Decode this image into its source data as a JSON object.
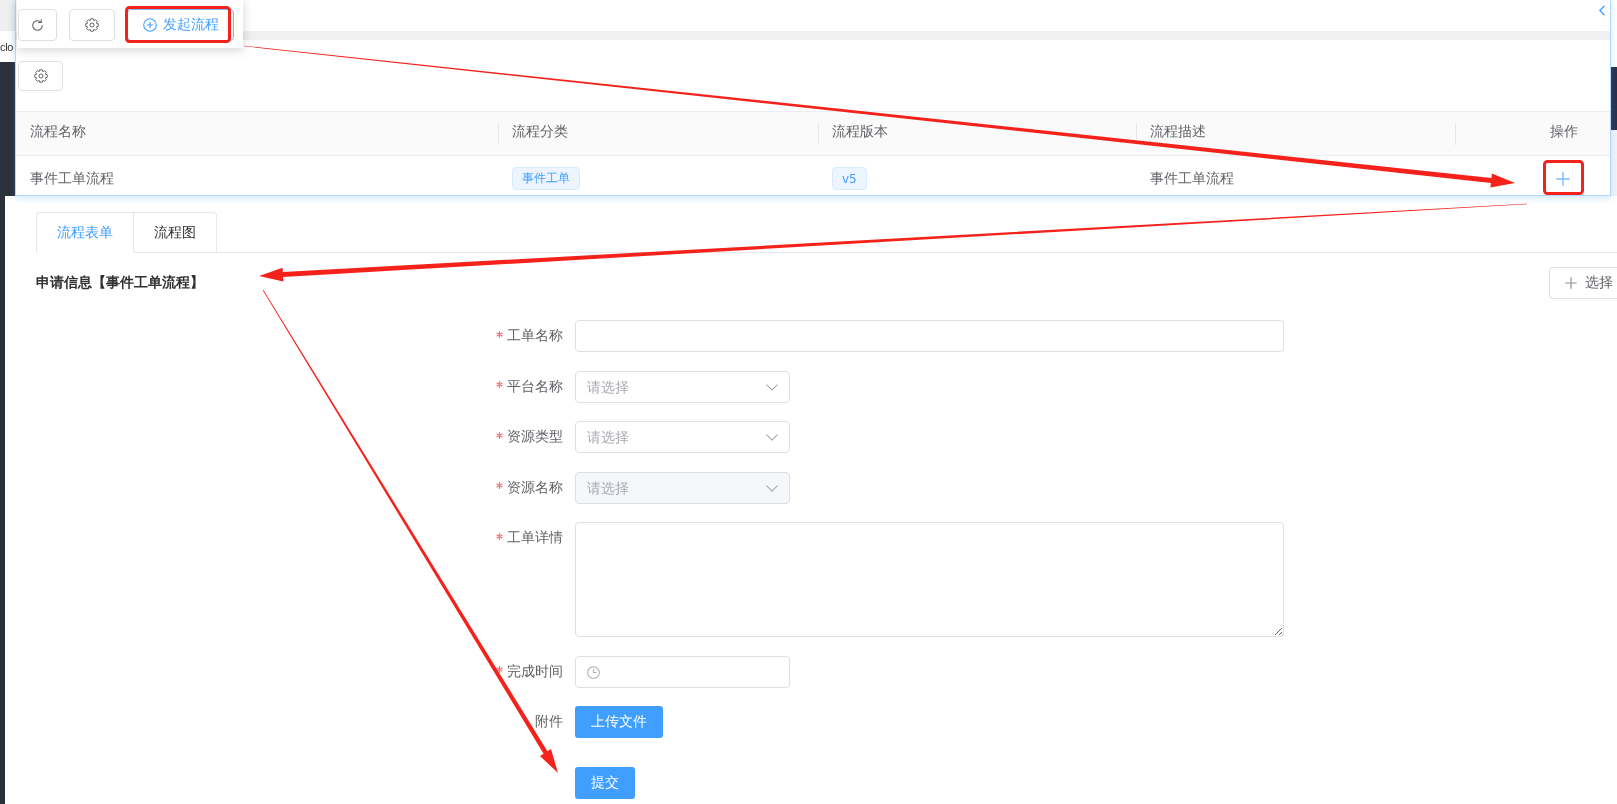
{
  "left_edge": {
    "text": "clo"
  },
  "toolbar_popup": {
    "buttons": [
      {
        "kind": "refresh"
      },
      {
        "kind": "settings"
      },
      {
        "kind": "add",
        "label": "发起流程"
      }
    ]
  },
  "process_table": {
    "columns": [
      "流程名称",
      "流程分类",
      "流程版本",
      "流程描述",
      "操作"
    ],
    "rows": [
      {
        "name": "事件工单流程",
        "category": "事件工单",
        "version": "v5",
        "description": "事件工单流程"
      }
    ]
  },
  "tabs": [
    {
      "label": "流程表单",
      "selected": true
    },
    {
      "label": "流程图",
      "selected": false
    }
  ],
  "section": {
    "title": "申请信息【事件工单流程】",
    "action_button": "选择"
  },
  "form": {
    "fields": [
      {
        "label": "工单名称",
        "required": true,
        "disabled": false,
        "kind": "text"
      },
      {
        "label": "平台名称",
        "required": true,
        "disabled": false,
        "kind": "select",
        "placeholder": "请选择"
      },
      {
        "label": "资源类型",
        "required": true,
        "disabled": false,
        "kind": "select",
        "placeholder": "请选择"
      },
      {
        "label": "资源名称",
        "required": true,
        "disabled": true,
        "kind": "select",
        "placeholder": "请选择"
      },
      {
        "label": "工单详情",
        "required": true,
        "disabled": false,
        "kind": "textarea"
      },
      {
        "label": "完成时间",
        "required": true,
        "disabled": false,
        "kind": "time"
      },
      {
        "label": "附件",
        "required": false,
        "disabled": false,
        "kind": "upload",
        "button": "上传文件"
      }
    ],
    "submit_button": "提交"
  }
}
